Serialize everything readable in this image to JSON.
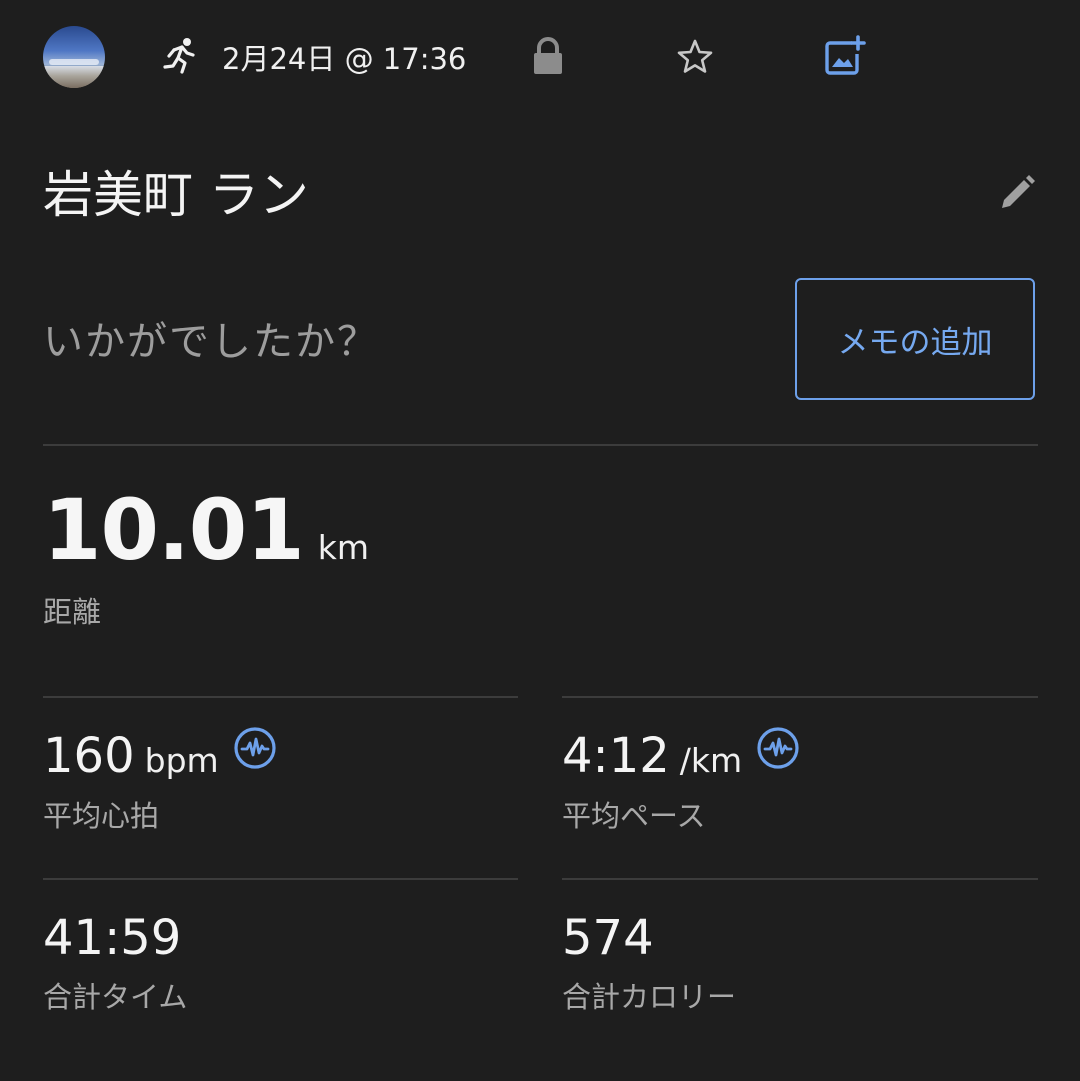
{
  "header": {
    "activity_icon": "running-person-icon",
    "datetime": "2月24日 @ 17:36",
    "privacy_icon": "lock-icon",
    "favorite_icon": "star-outline-icon",
    "add_photo_icon": "add-photo-icon",
    "accent_color": "#6da0ea"
  },
  "activity": {
    "title": "岩美町 ラン",
    "edit_icon": "pencil-icon",
    "feedback_prompt": "いかがでしたか？",
    "add_memo_label": "メモの追加"
  },
  "distance": {
    "value": "10.01",
    "unit": "km",
    "label": "距離"
  },
  "stats": {
    "heart_rate": {
      "value": "160",
      "unit": "bpm",
      "label": "平均心拍",
      "badge_icon": "heart-rate-monitor-icon"
    },
    "pace": {
      "value": "4:12",
      "unit": "/km",
      "label": "平均ペース",
      "badge_icon": "heart-rate-monitor-icon"
    },
    "total_time": {
      "value": "41:59",
      "label": "合計タイム"
    },
    "calories": {
      "value": "574",
      "label": "合計カロリー"
    }
  }
}
